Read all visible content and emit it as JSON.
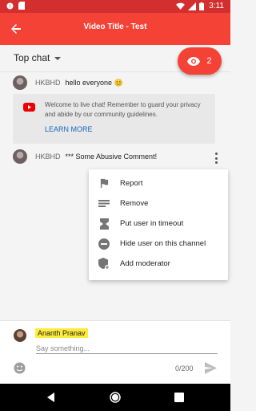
{
  "status_bar": {
    "time": "3:11"
  },
  "app_bar": {
    "title": "Video Title - Test"
  },
  "chat_header": {
    "mode": "Top chat"
  },
  "viewers": {
    "count": "2"
  },
  "messages": [
    {
      "author": "HKBHD",
      "text": "hello everyone 😊"
    },
    {
      "author": "HKBHD",
      "text": "*** Some Abusive Comment!"
    }
  ],
  "welcome": {
    "text": "Welcome to live chat! Remember to guard your privacy and abide by our community guidelines.",
    "link": "LEARN MORE"
  },
  "context_menu": {
    "items": [
      {
        "label": "Report",
        "icon": "flag-icon"
      },
      {
        "label": "Remove",
        "icon": "remove-icon"
      },
      {
        "label": "Put user in timeout",
        "icon": "hourglass-icon"
      },
      {
        "label": "Hide user on this channel",
        "icon": "block-icon"
      },
      {
        "label": "Add moderator",
        "icon": "shield-add-icon"
      }
    ]
  },
  "input": {
    "user_name": "Ananth Pranav",
    "placeholder": "Say something...",
    "counter": "0/200"
  },
  "colors": {
    "accent": "#f44336",
    "status_bar": "#d32f2f",
    "link": "#1565c0",
    "name_highlight": "#ffeb3b"
  }
}
